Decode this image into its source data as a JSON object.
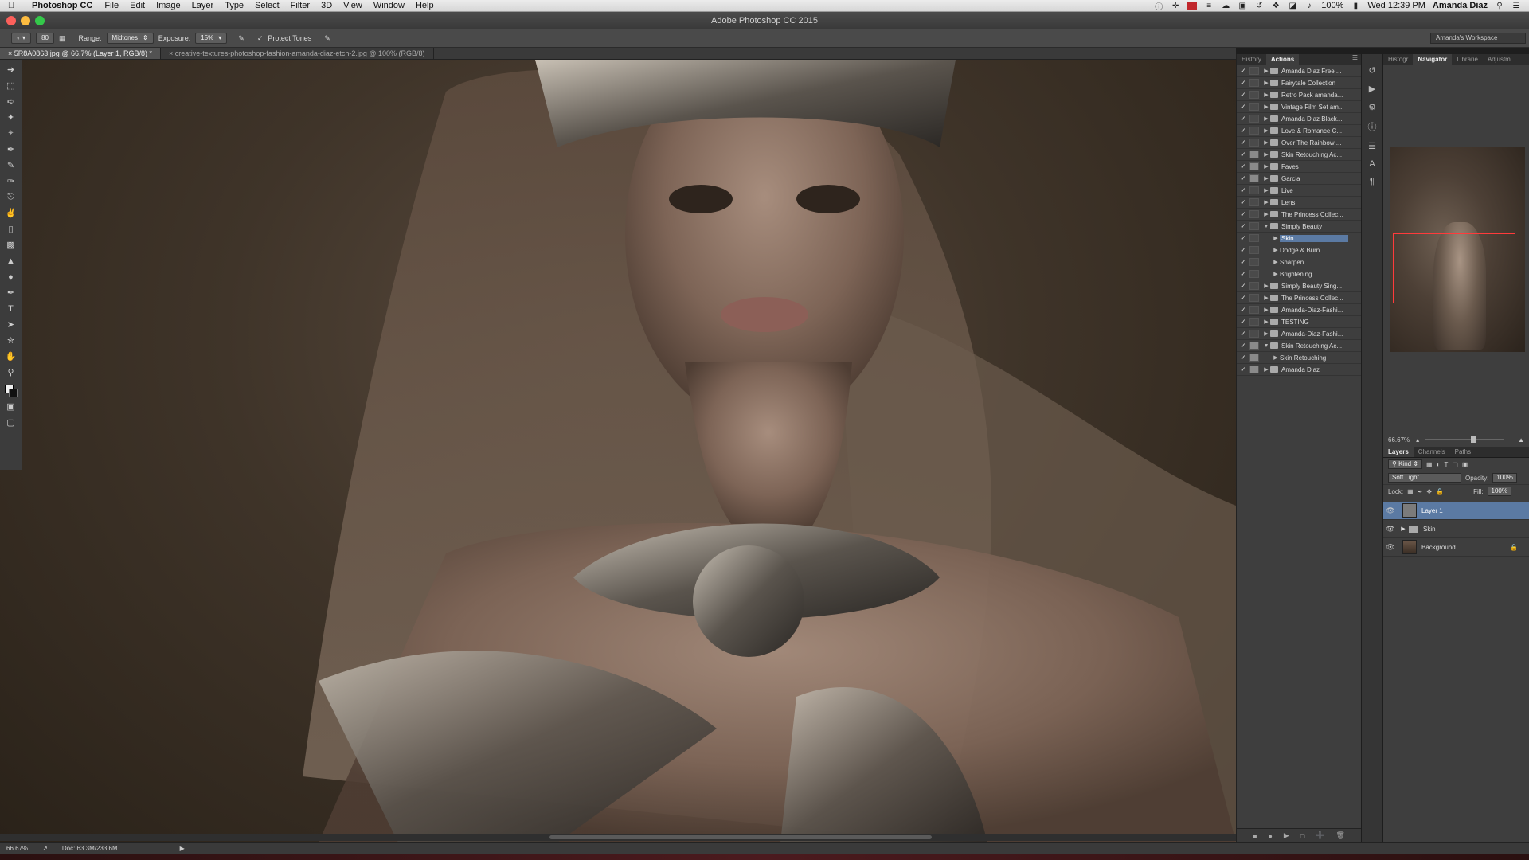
{
  "menubar": {
    "app": "Photoshop CC",
    "items": [
      "File",
      "Edit",
      "Image",
      "Layer",
      "Type",
      "Select",
      "Filter",
      "3D",
      "View",
      "Window",
      "Help"
    ],
    "battery": "100%",
    "clock": "Wed 12:39 PM",
    "user": "Amanda Diaz"
  },
  "window_title": "Adobe Photoshop CC 2015",
  "options": {
    "brush_size": "80",
    "range_label": "Range:",
    "range_value": "Midtones",
    "exposure_label": "Exposure:",
    "exposure_value": "15%",
    "protect_tones": "Protect Tones",
    "workspace": "Amanda's Workspace"
  },
  "doc_tabs": [
    "5R8A0863.jpg @ 66.7% (Layer 1, RGB/8) *",
    "creative-textures-photoshop-fashion-amanda-diaz-etch-2.jpg @ 100% (RGB/8)"
  ],
  "actions_panel": {
    "tabs": [
      "History",
      "Actions"
    ],
    "items": [
      {
        "label": "Amanda Diaz Free ...",
        "indent": 0,
        "open": false,
        "dialog": false,
        "selected": false
      },
      {
        "label": "Fairytale Collection",
        "indent": 0,
        "open": false,
        "dialog": false,
        "selected": false
      },
      {
        "label": "Retro Pack amanda...",
        "indent": 0,
        "open": false,
        "dialog": false,
        "selected": false
      },
      {
        "label": "Vintage Film Set am...",
        "indent": 0,
        "open": false,
        "dialog": false,
        "selected": false
      },
      {
        "label": "Amanda Diaz Black...",
        "indent": 0,
        "open": false,
        "dialog": false,
        "selected": false
      },
      {
        "label": "Love & Romance C...",
        "indent": 0,
        "open": false,
        "dialog": false,
        "selected": false
      },
      {
        "label": "Over The Rainbow ...",
        "indent": 0,
        "open": false,
        "dialog": false,
        "selected": false
      },
      {
        "label": "Skin Retouching Ac...",
        "indent": 0,
        "open": false,
        "dialog": true,
        "selected": false
      },
      {
        "label": "Faves",
        "indent": 0,
        "open": false,
        "dialog": true,
        "selected": false
      },
      {
        "label": "Garcia",
        "indent": 0,
        "open": false,
        "dialog": true,
        "selected": false
      },
      {
        "label": "Live",
        "indent": 0,
        "open": false,
        "dialog": false,
        "selected": false
      },
      {
        "label": "Lens",
        "indent": 0,
        "open": false,
        "dialog": false,
        "selected": false
      },
      {
        "label": "The Princess Collec...",
        "indent": 0,
        "open": false,
        "dialog": false,
        "selected": false
      },
      {
        "label": "Simply Beauty",
        "indent": 0,
        "open": true,
        "dialog": false,
        "selected": false
      },
      {
        "label": "Skin",
        "indent": 1,
        "open": false,
        "dialog": false,
        "selected": true
      },
      {
        "label": "Dodge & Burn",
        "indent": 1,
        "open": false,
        "dialog": false,
        "selected": false
      },
      {
        "label": "Sharpen",
        "indent": 1,
        "open": false,
        "dialog": false,
        "selected": false
      },
      {
        "label": "Brightening",
        "indent": 1,
        "open": false,
        "dialog": false,
        "selected": false
      },
      {
        "label": "Simply Beauty Sing...",
        "indent": 0,
        "open": false,
        "dialog": false,
        "selected": false
      },
      {
        "label": "The Princess Collec...",
        "indent": 0,
        "open": false,
        "dialog": false,
        "selected": false
      },
      {
        "label": "Amanda-Diaz-Fashi...",
        "indent": 0,
        "open": false,
        "dialog": false,
        "selected": false
      },
      {
        "label": "TESTING",
        "indent": 0,
        "open": false,
        "dialog": false,
        "selected": false
      },
      {
        "label": "Amanda-Diaz-Fashi...",
        "indent": 0,
        "open": false,
        "dialog": false,
        "selected": false
      },
      {
        "label": "Skin Retouching Ac...",
        "indent": 0,
        "open": true,
        "dialog": true,
        "selected": false
      },
      {
        "label": "Skin Retouching",
        "indent": 1,
        "open": false,
        "dialog": true,
        "selected": false
      },
      {
        "label": "Amanda Diaz",
        "indent": 0,
        "open": false,
        "dialog": true,
        "selected": false
      }
    ]
  },
  "navigator": {
    "tabs": [
      "Histogr",
      "Navigator",
      "Librarie",
      "Adjustm"
    ],
    "zoom": "66.67%"
  },
  "layers_panel": {
    "tabs": [
      "Layers",
      "Channels",
      "Paths"
    ],
    "kind": "Kind",
    "blend_mode": "Soft Light",
    "opacity_label": "Opacity:",
    "opacity": "100%",
    "lock_label": "Lock:",
    "fill_label": "Fill:",
    "fill": "100%",
    "layers": [
      {
        "name": "Layer 1",
        "selected": true,
        "group": false,
        "locked": false
      },
      {
        "name": "Skin",
        "selected": false,
        "group": true,
        "locked": false
      },
      {
        "name": "Background",
        "selected": false,
        "group": false,
        "locked": true
      }
    ]
  },
  "status": {
    "zoom": "66.67%",
    "doc": "Doc: 63.3M/233.6M"
  },
  "colors": {
    "selection": "#5b7aa3",
    "nav_box": "#ff3b3b"
  }
}
